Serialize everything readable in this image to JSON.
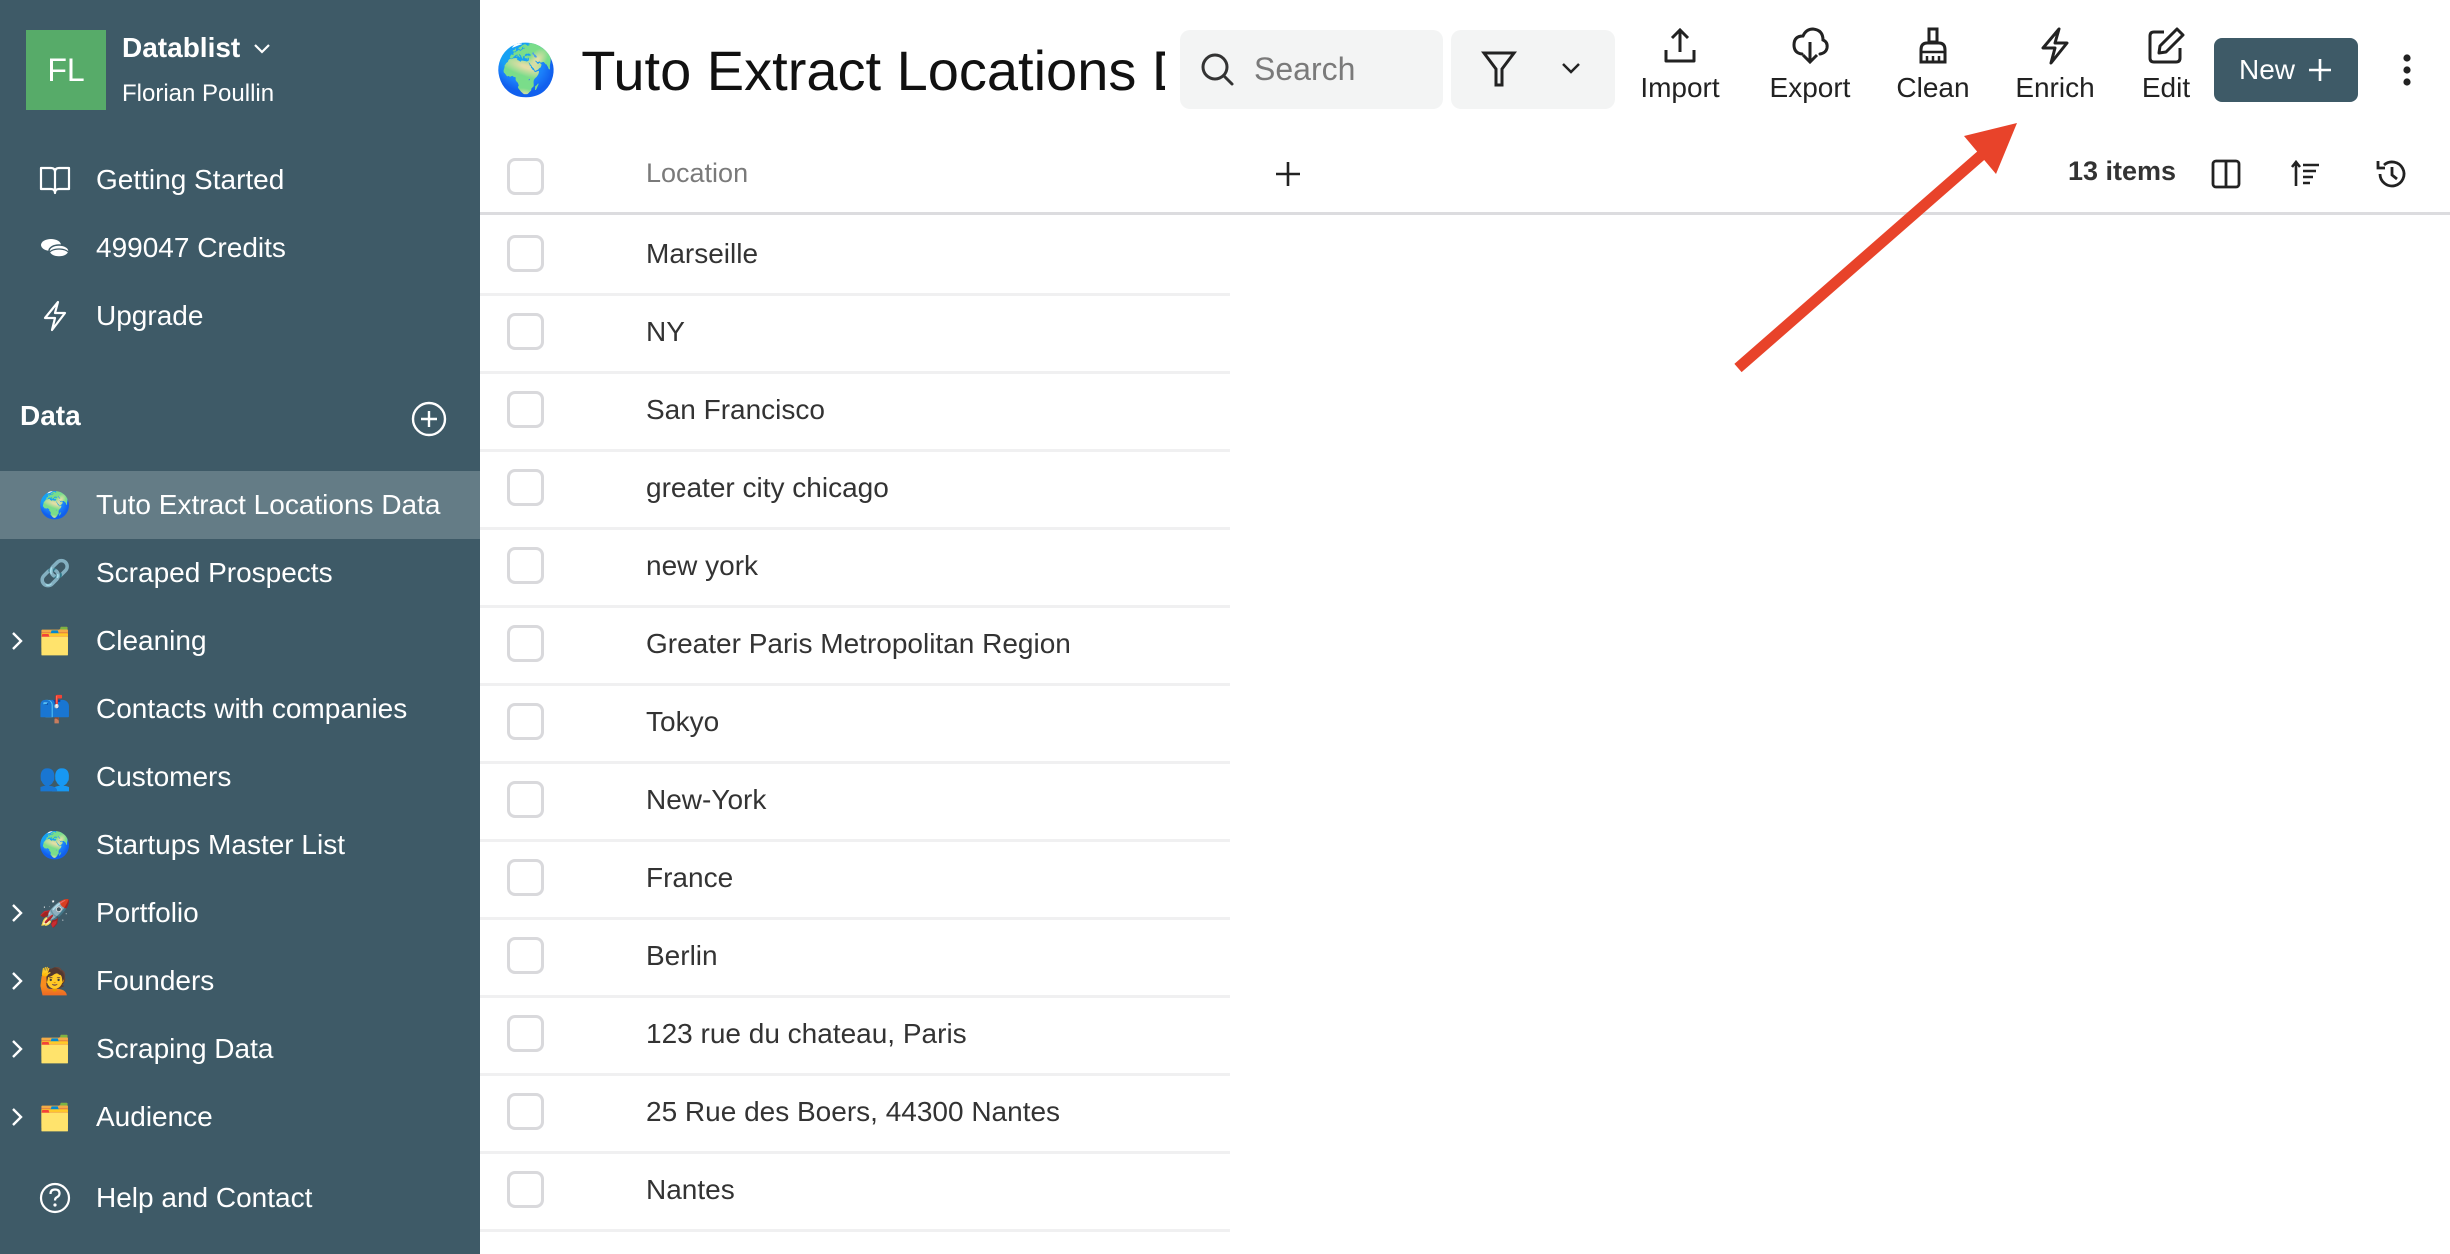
{
  "workspace": {
    "avatar_initials": "FL",
    "avatar_color": "#57ab69",
    "name": "Datablist",
    "user": "Florian Poullin"
  },
  "sidebar": {
    "bg_color": "#3e5a67",
    "active_color": "#647c86",
    "top_items": [
      {
        "label": "Getting Started",
        "icon": "book-icon"
      },
      {
        "label": "499047 Credits",
        "icon": "coins-icon"
      },
      {
        "label": "Upgrade",
        "icon": "lightning-icon"
      }
    ],
    "data_section_label": "Data",
    "data_items": [
      {
        "label": "Tuto Extract Locations Data",
        "emoji": "🌍",
        "icon": "globe-icon",
        "expandable": false,
        "active": true
      },
      {
        "label": "Scraped Prospects",
        "emoji": "🔗",
        "icon": "link-icon",
        "expandable": false,
        "active": false
      },
      {
        "label": "Cleaning",
        "emoji": "🗂️",
        "icon": "card-index-dividers-icon",
        "expandable": true,
        "active": false
      },
      {
        "label": "Contacts with companies",
        "emoji": "📫",
        "icon": "mailbox-icon",
        "expandable": false,
        "active": false
      },
      {
        "label": "Customers",
        "emoji": "👥",
        "icon": "people-icon",
        "expandable": false,
        "active": false
      },
      {
        "label": "Startups Master List",
        "emoji": "🌍",
        "icon": "globe-icon",
        "expandable": false,
        "active": false
      },
      {
        "label": "Portfolio",
        "emoji": "🚀",
        "icon": "rocket-icon",
        "expandable": true,
        "active": false
      },
      {
        "label": "Founders",
        "emoji": "🙋",
        "icon": "person-raising-hand-icon",
        "expandable": true,
        "active": false
      },
      {
        "label": "Scraping Data",
        "emoji": "🗂️",
        "icon": "card-index-dividers-icon",
        "expandable": true,
        "active": false
      },
      {
        "label": "Audience",
        "emoji": "🗂️",
        "icon": "card-index-dividers-icon",
        "expandable": true,
        "active": false
      }
    ],
    "help_label": "Help and Contact"
  },
  "header": {
    "title_emoji": "🌍",
    "title": "Tuto Extract Locations Data",
    "search_placeholder": "Search",
    "tools": [
      {
        "label": "Import",
        "icon": "upload-icon"
      },
      {
        "label": "Export",
        "icon": "cloud-download-icon"
      },
      {
        "label": "Clean",
        "icon": "broom-icon"
      },
      {
        "label": "Enrich",
        "icon": "lightning-icon"
      },
      {
        "label": "Edit",
        "icon": "edit-icon"
      }
    ],
    "new_label": "New",
    "new_button_color": "#3e5a67"
  },
  "table": {
    "columns": [
      "Location"
    ],
    "item_count": "13 items",
    "rows": [
      "Marseille",
      "NY",
      "San Francisco",
      "greater city chicago",
      "new york",
      "Greater Paris Metropolitan Region",
      "Tokyo",
      "New-York",
      "France",
      "Berlin",
      "123 rue du chateau, Paris",
      "25 Rue des Boers, 44300 Nantes",
      "Nantes"
    ]
  },
  "annotation": {
    "arrow_color": "#e8432a",
    "points_to": "Enrich"
  }
}
